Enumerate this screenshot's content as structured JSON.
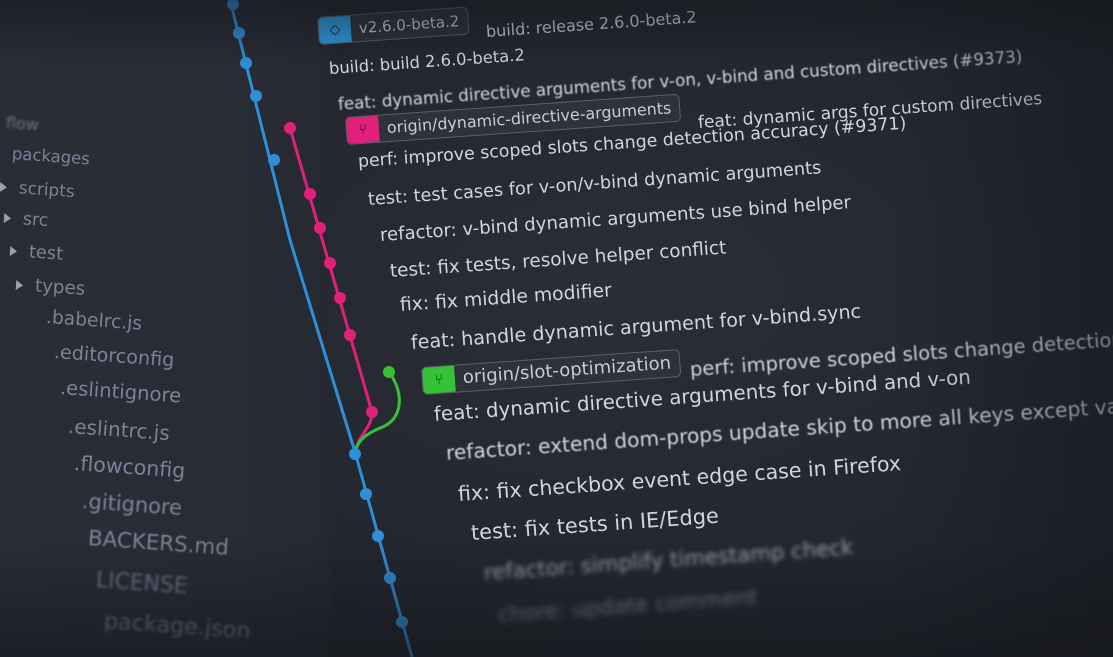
{
  "sidebar": {
    "items": [
      {
        "label": "flow",
        "caret": false
      },
      {
        "label": "packages",
        "caret": false
      },
      {
        "label": "scripts",
        "caret": true
      },
      {
        "label": "src",
        "caret": true
      },
      {
        "label": "test",
        "caret": true
      },
      {
        "label": "types",
        "caret": true
      },
      {
        "label": ".babelrc.js",
        "caret": false
      },
      {
        "label": ".editorconfig",
        "caret": false
      },
      {
        "label": ".eslintignore",
        "caret": false
      },
      {
        "label": ".eslintrc.js",
        "caret": false
      },
      {
        "label": ".flowconfig",
        "caret": false
      },
      {
        "label": ".gitignore",
        "caret": false
      },
      {
        "label": "BACKERS.md",
        "caret": false
      },
      {
        "label": "LICENSE",
        "caret": false
      },
      {
        "label": "package.json",
        "caret": false
      }
    ]
  },
  "colors": {
    "background": "#24272f",
    "main_branch": "#2e8fd8",
    "feature_branch": "#e0207a",
    "slot_branch": "#35c236",
    "text": "#d2d5de",
    "sidebar_text": "#7d8299"
  },
  "tags": {
    "release": {
      "label": "v2.6.0-beta.2",
      "icon": "tag-icon"
    },
    "dynamic": {
      "label": "origin/dynamic-directive-arguments",
      "icon": "branch-icon"
    },
    "slot": {
      "label": "origin/slot-optimization",
      "icon": "branch-icon"
    }
  },
  "commits": [
    {
      "message": "build: release 2.6.0-beta.2",
      "tag": "release"
    },
    {
      "message": "build: build 2.6.0-beta.2"
    },
    {
      "message": "feat: dynamic directive arguments for v-on, v-bind and custom directives (#9373)"
    },
    {
      "message": "feat: dynamic args for custom directives",
      "tag": "dynamic"
    },
    {
      "message": "perf: improve scoped slots change detection accuracy (#9371)"
    },
    {
      "message": "test: test cases for v-on/v-bind dynamic arguments"
    },
    {
      "message": "refactor: v-bind dynamic arguments use bind helper"
    },
    {
      "message": "test: fix tests, resolve helper conflict"
    },
    {
      "message": "fix: fix middle modifier"
    },
    {
      "message": "feat: handle dynamic argument for v-bind.sync"
    },
    {
      "message": "perf: improve scoped slots change detection accuracy",
      "tag": "slot"
    },
    {
      "message": "feat: dynamic directive arguments for v-bind and v-on"
    },
    {
      "message": "refactor: extend dom-props update skip to more all keys except value"
    },
    {
      "message": "fix: fix checkbox event edge case in Firefox"
    },
    {
      "message": "test: fix tests in IE/Edge"
    },
    {
      "message": "refactor: simplify timestamp check"
    },
    {
      "message": "chore: update comment"
    }
  ]
}
